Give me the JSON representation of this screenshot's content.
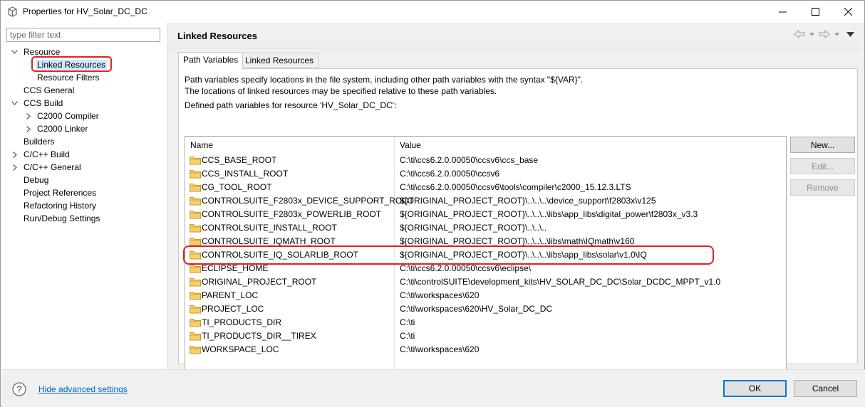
{
  "window": {
    "title": "Properties for HV_Solar_DC_DC"
  },
  "filter": {
    "placeholder": "type filter text"
  },
  "tree": {
    "resource": "Resource",
    "linked_resources": "Linked Resources",
    "resource_filters": "Resource Filters",
    "ccs_general": "CCS General",
    "ccs_build": "CCS Build",
    "c2000_compiler": "C2000 Compiler",
    "c2000_linker": "C2000 Linker",
    "builders": "Builders",
    "cpp_build": "C/C++ Build",
    "cpp_general": "C/C++ General",
    "debug": "Debug",
    "project_references": "Project References",
    "refactoring_history": "Refactoring History",
    "run_debug_settings": "Run/Debug Settings"
  },
  "page": {
    "title": "Linked Resources",
    "tabs": [
      "Path Variables",
      "Linked Resources"
    ],
    "desc1": "Path variables specify locations in the file system, including other path variables with the syntax \"${VAR}\".",
    "desc2": "The locations of linked resources may be specified relative to these path variables.",
    "defined_label": "Defined path variables for resource 'HV_Solar_DC_DC':"
  },
  "table": {
    "headers": {
      "name": "Name",
      "value": "Value"
    },
    "rows": [
      {
        "name": "CCS_BASE_ROOT",
        "value": "C:\\ti\\ccs6.2.0.00050\\ccsv6\\ccs_base"
      },
      {
        "name": "CCS_INSTALL_ROOT",
        "value": "C:\\ti\\ccs6.2.0.00050\\ccsv6"
      },
      {
        "name": "CG_TOOL_ROOT",
        "value": "C:\\ti\\ccs6.2.0.00050\\ccsv6\\tools\\compiler\\c2000_15.12.3.LTS"
      },
      {
        "name": "CONTROLSUITE_F2803x_DEVICE_SUPPORT_ROOT",
        "value": "${ORIGINAL_PROJECT_ROOT}\\..\\..\\..\\device_support\\f2803x\\v125"
      },
      {
        "name": "CONTROLSUITE_F2803x_POWERLIB_ROOT",
        "value": "${ORIGINAL_PROJECT_ROOT}\\..\\..\\..\\libs\\app_libs\\digital_power\\f2803x_v3.3"
      },
      {
        "name": "CONTROLSUITE_INSTALL_ROOT",
        "value": "${ORIGINAL_PROJECT_ROOT}\\..\\..\\.."
      },
      {
        "name": "CONTROLSUITE_IQMATH_ROOT",
        "value": "${ORIGINAL_PROJECT_ROOT}\\..\\..\\..\\libs\\math\\IQmath\\v160"
      },
      {
        "name": "CONTROLSUITE_IQ_SOLARLIB_ROOT",
        "value": "${ORIGINAL_PROJECT_ROOT}\\..\\..\\..\\libs\\app_libs\\solar\\v1.0\\IQ"
      },
      {
        "name": "ECLIPSE_HOME",
        "value": "C:\\ti\\ccs6.2.0.00050\\ccsv6\\eclipse\\"
      },
      {
        "name": "ORIGINAL_PROJECT_ROOT",
        "value": "C:\\ti\\controlSUITE\\development_kits\\HV_SOLAR_DC_DC\\Solar_DCDC_MPPT_v1.0"
      },
      {
        "name": "PARENT_LOC",
        "value": "C:\\ti\\workspaces\\620"
      },
      {
        "name": "PROJECT_LOC",
        "value": "C:\\ti\\workspaces\\620\\HV_Solar_DC_DC"
      },
      {
        "name": "TI_PRODUCTS_DIR",
        "value": "C:\\ti"
      },
      {
        "name": "TI_PRODUCTS_DIR__TIREX",
        "value": "C:\\ti"
      },
      {
        "name": "WORKSPACE_LOC",
        "value": "C:\\ti\\workspaces\\620"
      }
    ]
  },
  "buttons": {
    "new": "New...",
    "edit": "Edit...",
    "remove": "Remove",
    "ok": "OK",
    "cancel": "Cancel"
  },
  "footer": {
    "advanced_link": "Hide advanced settings"
  },
  "colors": {
    "highlight": "#e02020",
    "selection": "#cce8ff",
    "link": "#0066cc",
    "folder": "#e8b94a"
  },
  "icons": {
    "app": "properties-app-icon",
    "help": "help-icon",
    "folder": "folder-icon",
    "back": "back-arrow-icon",
    "forward": "forward-arrow-icon",
    "menu": "view-menu-icon"
  }
}
